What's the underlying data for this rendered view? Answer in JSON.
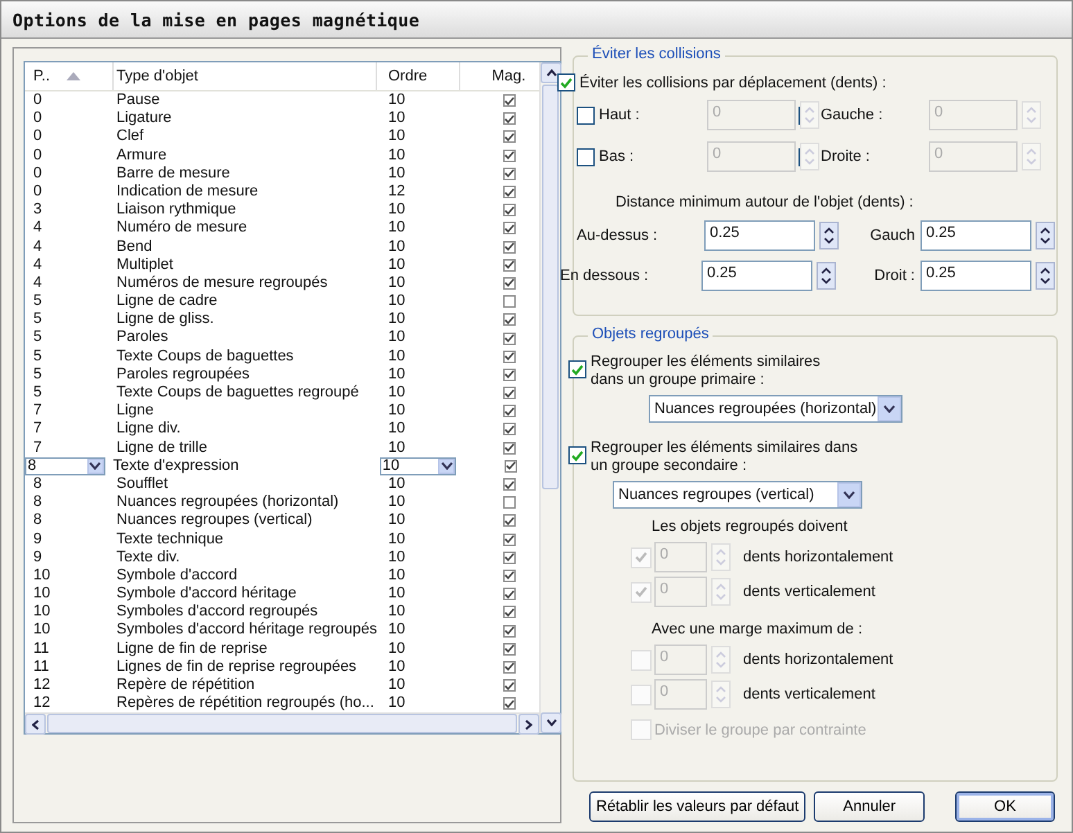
{
  "window": {
    "title": "Options de la mise en pages magnétique"
  },
  "table": {
    "columns": [
      {
        "label": "P..",
        "sorted": true
      },
      {
        "label": "Type d'objet",
        "sorted": false
      },
      {
        "label": "Ordre",
        "sorted": false
      },
      {
        "label": "Mag.",
        "sorted": false
      }
    ],
    "rows": [
      {
        "priority": "0",
        "type": "Pause",
        "order": "10",
        "magnetic": true,
        "editing": false
      },
      {
        "priority": "0",
        "type": "Ligature",
        "order": "10",
        "magnetic": true,
        "editing": false
      },
      {
        "priority": "0",
        "type": "Clef",
        "order": "10",
        "magnetic": true,
        "editing": false
      },
      {
        "priority": "0",
        "type": "Armure",
        "order": "10",
        "magnetic": true,
        "editing": false
      },
      {
        "priority": "0",
        "type": "Barre de mesure",
        "order": "10",
        "magnetic": true,
        "editing": false
      },
      {
        "priority": "0",
        "type": "Indication de mesure",
        "order": "12",
        "magnetic": true,
        "editing": false
      },
      {
        "priority": "3",
        "type": "Liaison rythmique",
        "order": "10",
        "magnetic": true,
        "editing": false
      },
      {
        "priority": "4",
        "type": "Numéro de mesure",
        "order": "10",
        "magnetic": true,
        "editing": false
      },
      {
        "priority": "4",
        "type": "Bend",
        "order": "10",
        "magnetic": true,
        "editing": false
      },
      {
        "priority": "4",
        "type": "Multiplet",
        "order": "10",
        "magnetic": true,
        "editing": false
      },
      {
        "priority": "4",
        "type": "Numéros de mesure regroupés",
        "order": "10",
        "magnetic": true,
        "editing": false
      },
      {
        "priority": "5",
        "type": "Ligne de cadre",
        "order": "10",
        "magnetic": false,
        "editing": false
      },
      {
        "priority": "5",
        "type": "Ligne de gliss.",
        "order": "10",
        "magnetic": true,
        "editing": false
      },
      {
        "priority": "5",
        "type": "Paroles",
        "order": "10",
        "magnetic": true,
        "editing": false
      },
      {
        "priority": "5",
        "type": "Texte Coups de baguettes",
        "order": "10",
        "magnetic": true,
        "editing": false
      },
      {
        "priority": "5",
        "type": "Paroles regroupées",
        "order": "10",
        "magnetic": true,
        "editing": false
      },
      {
        "priority": "5",
        "type": "Texte Coups de baguettes regroupé",
        "order": "10",
        "magnetic": true,
        "editing": false
      },
      {
        "priority": "7",
        "type": "Ligne",
        "order": "10",
        "magnetic": true,
        "editing": false
      },
      {
        "priority": "7",
        "type": "Ligne div.",
        "order": "10",
        "magnetic": true,
        "editing": false
      },
      {
        "priority": "7",
        "type": "Ligne de trille",
        "order": "10",
        "magnetic": true,
        "editing": false
      },
      {
        "priority": "8",
        "type": "Texte d'expression",
        "order": "10",
        "magnetic": true,
        "editing": true
      },
      {
        "priority": "8",
        "type": "Soufflet",
        "order": "10",
        "magnetic": true,
        "editing": false
      },
      {
        "priority": "8",
        "type": "Nuances regroupées (horizontal)",
        "order": "10",
        "magnetic": false,
        "editing": false
      },
      {
        "priority": "8",
        "type": "Nuances regroupes (vertical)",
        "order": "10",
        "magnetic": true,
        "editing": false
      },
      {
        "priority": "9",
        "type": "Texte technique",
        "order": "10",
        "magnetic": true,
        "editing": false
      },
      {
        "priority": "9",
        "type": "Texte div.",
        "order": "10",
        "magnetic": true,
        "editing": false
      },
      {
        "priority": "10",
        "type": "Symbole d'accord",
        "order": "10",
        "magnetic": true,
        "editing": false
      },
      {
        "priority": "10",
        "type": "Symbole d'accord héritage",
        "order": "10",
        "magnetic": true,
        "editing": false
      },
      {
        "priority": "10",
        "type": "Symboles d'accord regroupés",
        "order": "10",
        "magnetic": true,
        "editing": false
      },
      {
        "priority": "10",
        "type": "Symboles d'accord héritage regroupés",
        "order": "10",
        "magnetic": true,
        "editing": false
      },
      {
        "priority": "11",
        "type": "Ligne de fin de reprise",
        "order": "10",
        "magnetic": true,
        "editing": false
      },
      {
        "priority": "11",
        "type": "Lignes de fin de reprise regroupées",
        "order": "10",
        "magnetic": true,
        "editing": false
      },
      {
        "priority": "12",
        "type": "Repère de répétition",
        "order": "10",
        "magnetic": true,
        "editing": false
      },
      {
        "priority": "12",
        "type": "Repères de répétition regroupés (ho...",
        "order": "10",
        "magnetic": true,
        "editing": false
      }
    ]
  },
  "collisions": {
    "title": "Éviter les collisions",
    "enable": {
      "label": "Éviter les collisions par déplacement (dents) :",
      "checked": true
    },
    "sides": [
      {
        "label": "Haut :",
        "checked": false,
        "value": "0",
        "disabled": true
      },
      {
        "label": "Gauche :",
        "checked": false,
        "value": "0",
        "disabled": true
      },
      {
        "label": "Bas :",
        "checked": false,
        "value": "0",
        "disabled": true
      },
      {
        "label": "Droite :",
        "checked": false,
        "value": "0",
        "disabled": true
      }
    ],
    "distance_label": "Distance minimum autour de l'objet (dents) :",
    "distances": [
      {
        "label": "Au-dessus :",
        "value": "0.25"
      },
      {
        "label": "Gauch",
        "value": "0.25"
      },
      {
        "label": "En dessous :",
        "value": "0.25"
      },
      {
        "label": "Droit :",
        "value": "0.25"
      }
    ]
  },
  "grouping": {
    "title": "Objets regroupés",
    "primary": {
      "label": "Regrouper les éléments similaires dans un groupe primaire :",
      "checked": true,
      "value": "Nuances regroupées (horizontal)"
    },
    "secondary": {
      "label": "Regrouper les éléments similaires dans un groupe secondaire :",
      "checked": true,
      "value": "Nuances regroupes (vertical)"
    },
    "must_label": "Les objets regroupés doivent",
    "must": [
      {
        "checked": true,
        "value": "0",
        "unit": "dents horizontalement",
        "disabled": true
      },
      {
        "checked": true,
        "value": "0",
        "unit": "dents verticalement",
        "disabled": true
      }
    ],
    "margin_label": "Avec une marge maximum de :",
    "margin": [
      {
        "checked": false,
        "value": "0",
        "unit": "dents horizontalement",
        "disabled": true
      },
      {
        "checked": false,
        "value": "0",
        "unit": "dents verticalement",
        "disabled": true
      }
    ],
    "split": {
      "label": "Diviser le groupe par contrainte",
      "checked": false,
      "disabled": true
    }
  },
  "buttons": [
    {
      "label": "Rétablir les valeurs par défaut",
      "default": false
    },
    {
      "label": "Annuler",
      "default": false
    },
    {
      "label": "OK",
      "default": true
    }
  ]
}
